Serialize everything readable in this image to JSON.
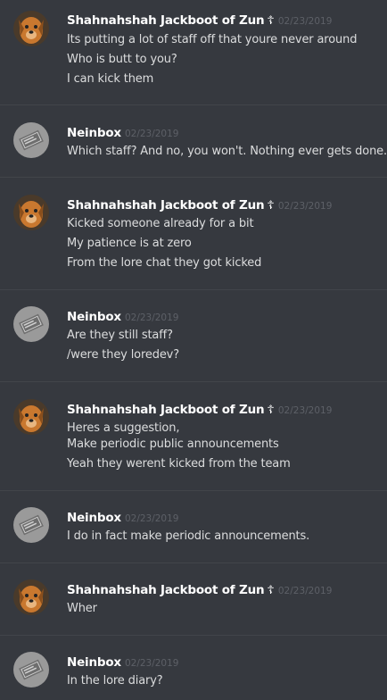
{
  "users": {
    "shah": {
      "name": "Shahnahshah Jackboot of Zun",
      "badge": "☦"
    },
    "nein": {
      "name": "Neinbox"
    }
  },
  "messages": [
    {
      "user": "shah",
      "timestamp": "02/23/2019",
      "lines": [
        "Its putting a lot of staff off that youre never around",
        "Who is butt to you?",
        "I can kick them"
      ]
    },
    {
      "user": "nein",
      "timestamp": "02/23/2019",
      "lines": [
        "Which staff? And no, you won't. Nothing ever gets done."
      ]
    },
    {
      "user": "shah",
      "timestamp": "02/23/2019",
      "lines": [
        "Kicked someone already for a bit",
        "My patience is at zero",
        "From the lore chat they got kicked"
      ]
    },
    {
      "user": "nein",
      "timestamp": "02/23/2019",
      "lines": [
        "Are they still staff?",
        "/were they loredev?"
      ]
    },
    {
      "user": "shah",
      "timestamp": "02/23/2019",
      "lines": [
        "Heres a suggestion,",
        "Make periodic public announcements",
        "Yeah they werent kicked from the team"
      ]
    },
    {
      "user": "nein",
      "timestamp": "02/23/2019",
      "lines": [
        "I do in fact make periodic announcements."
      ]
    },
    {
      "user": "shah",
      "timestamp": "02/23/2019",
      "lines": [
        "Wher"
      ]
    },
    {
      "user": "nein",
      "timestamp": "02/23/2019",
      "lines": [
        "In the lore diary?"
      ]
    }
  ]
}
